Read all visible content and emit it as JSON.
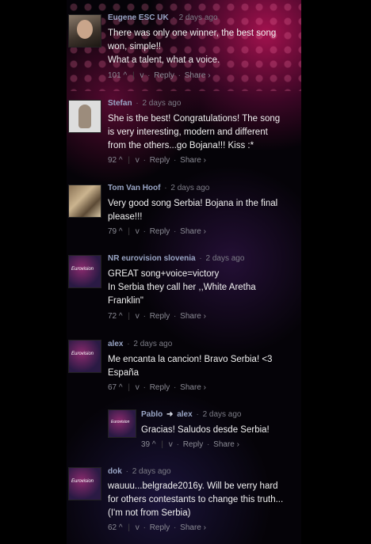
{
  "comments": [
    {
      "author": "Eugene ESC UK",
      "time": "2 days ago",
      "lines": [
        "There was only one winner, the best song",
        "won, simple!!",
        "What a talent, what a voice."
      ],
      "votes": "101",
      "reply": "Reply",
      "share": "Share ›"
    },
    {
      "author": "Stefan",
      "time": "2 days ago",
      "lines": [
        "She is the best! Congratulations! The song",
        "is very interesting, modern and different",
        "from the others...go Bojana!!! Kiss :*"
      ],
      "votes": "92",
      "reply": "Reply",
      "share": "Share ›"
    },
    {
      "author": "Tom Van Hoof",
      "time": "2 days ago",
      "lines": [
        "Very good song Serbia! Bojana in the final",
        "please!!!"
      ],
      "votes": "79",
      "reply": "Reply",
      "share": "Share ›"
    },
    {
      "author": "NR eurovision slovenia",
      "time": "2 days ago",
      "lines": [
        "GREAT song+voice=victory",
        "In Serbia they call her ,,White Aretha",
        "Franklin\""
      ],
      "votes": "72",
      "reply": "Reply",
      "share": "Share ›"
    },
    {
      "author": "alex",
      "time": "2 days ago",
      "lines": [
        "Me encanta la cancion! Bravo Serbia! <3",
        "España"
      ],
      "votes": "67",
      "reply": "Reply",
      "share": "Share ›"
    },
    {
      "author": "Pablo",
      "reply_to": "alex",
      "time": "2 days ago",
      "lines": [
        "Gracias! Saludos desde Serbia!"
      ],
      "votes": "39",
      "reply": "Reply",
      "share": "Share ›"
    },
    {
      "author": "dok",
      "time": "2 days ago",
      "lines": [
        "wauuu...belgrade2016y. Will be verry hard",
        "for others contestants to change this truth...",
        "(I'm not from Serbia)"
      ],
      "votes": "62",
      "reply": "Reply",
      "share": "Share ›"
    }
  ],
  "avatar_badge": "Eurovision",
  "separator": "·"
}
